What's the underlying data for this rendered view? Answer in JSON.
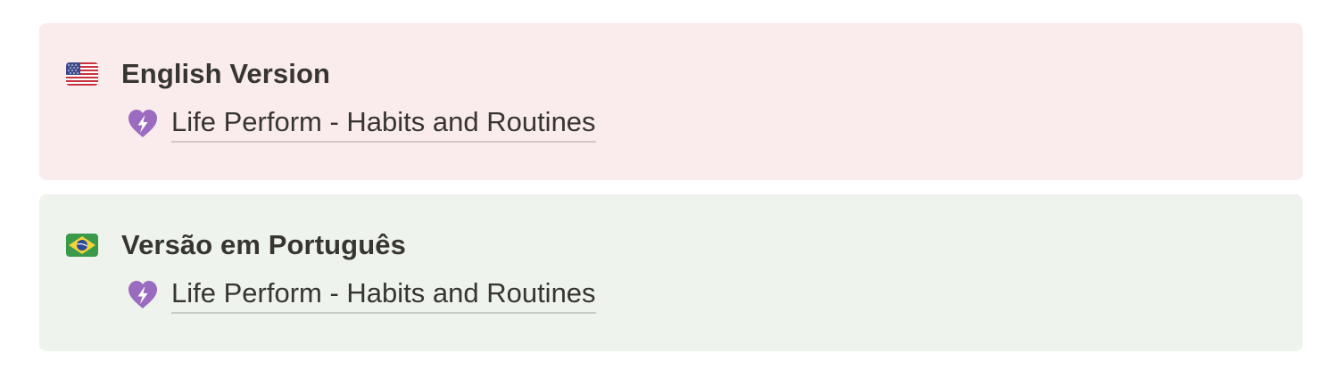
{
  "callouts": [
    {
      "flag": "us-flag-icon",
      "heading": "English Version",
      "background": "#faebec",
      "link": {
        "icon": "purple-heart-lightning-icon",
        "label": "Life Perform - Habits and Routines"
      }
    },
    {
      "flag": "brazil-flag-icon",
      "heading": "Versão em Português",
      "background": "#eef3ed",
      "link": {
        "icon": "purple-heart-lightning-icon",
        "label": "Life Perform - Habits and Routines"
      }
    }
  ],
  "colors": {
    "text": "#37352f",
    "heart": "#9b6bbf",
    "english_callout_bg": "#faebec",
    "portuguese_callout_bg": "#eef3ed"
  }
}
